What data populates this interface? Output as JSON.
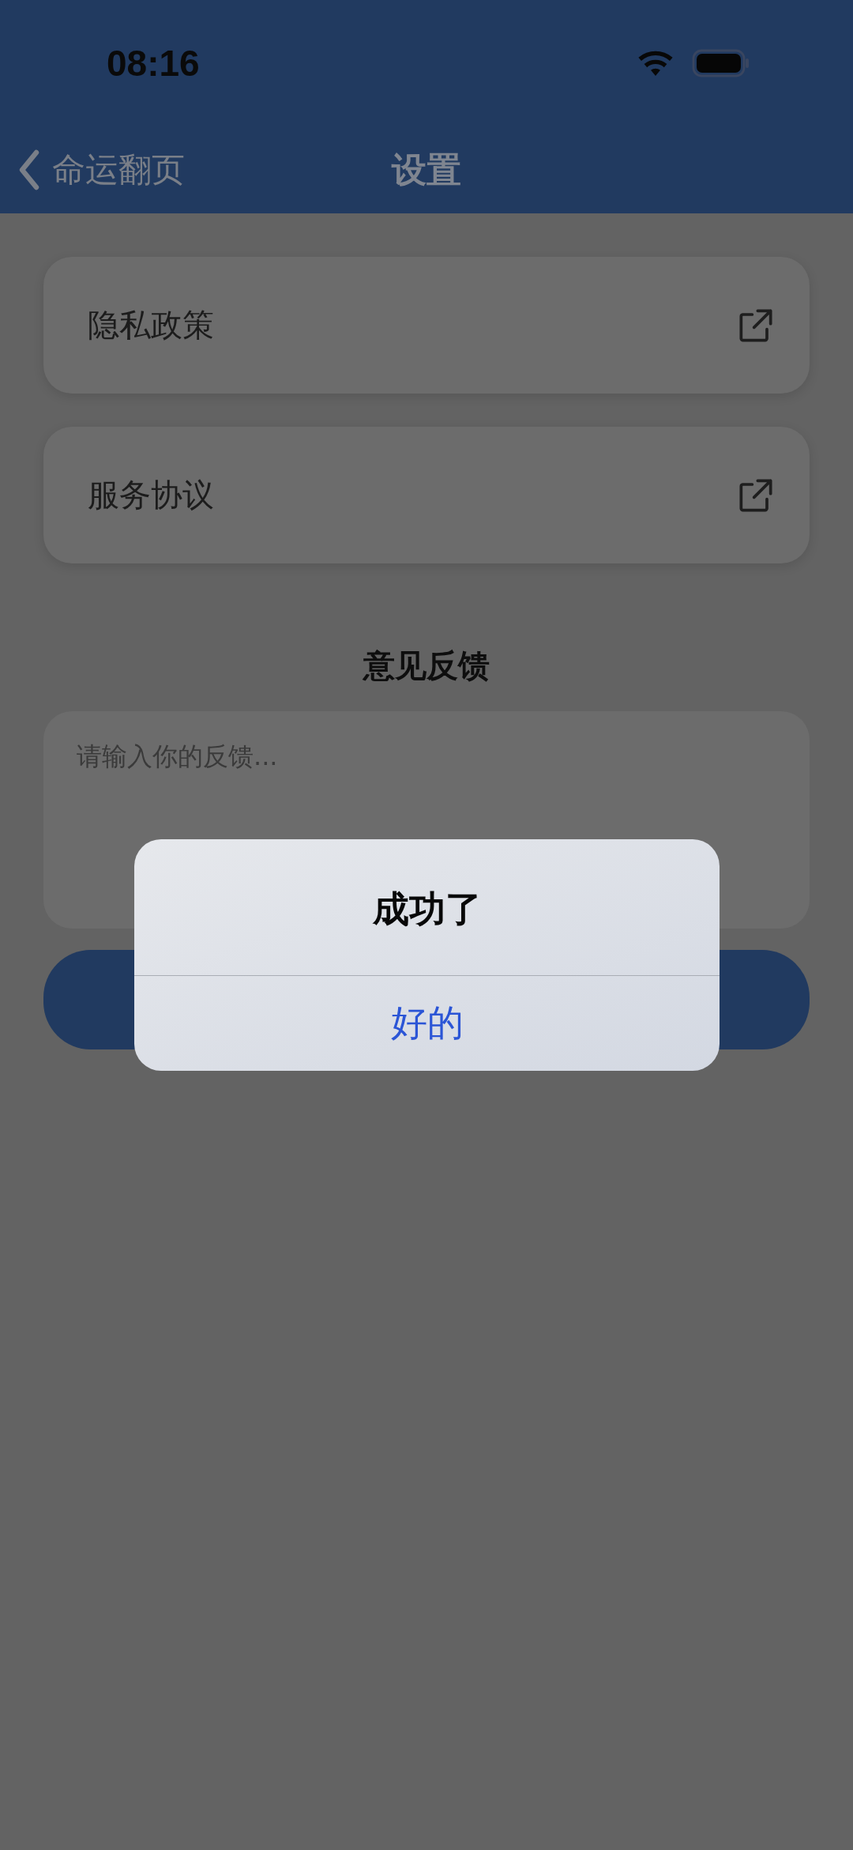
{
  "status_bar": {
    "time": "08:16"
  },
  "nav_bar": {
    "back_label": "命运翻页",
    "title": "设置"
  },
  "links": [
    {
      "label": "隐私政策"
    },
    {
      "label": "服务协议"
    }
  ],
  "feedback": {
    "heading": "意见反馈",
    "placeholder": "请输入你的反馈..."
  },
  "alert": {
    "title": "成功了",
    "button": "好的"
  }
}
